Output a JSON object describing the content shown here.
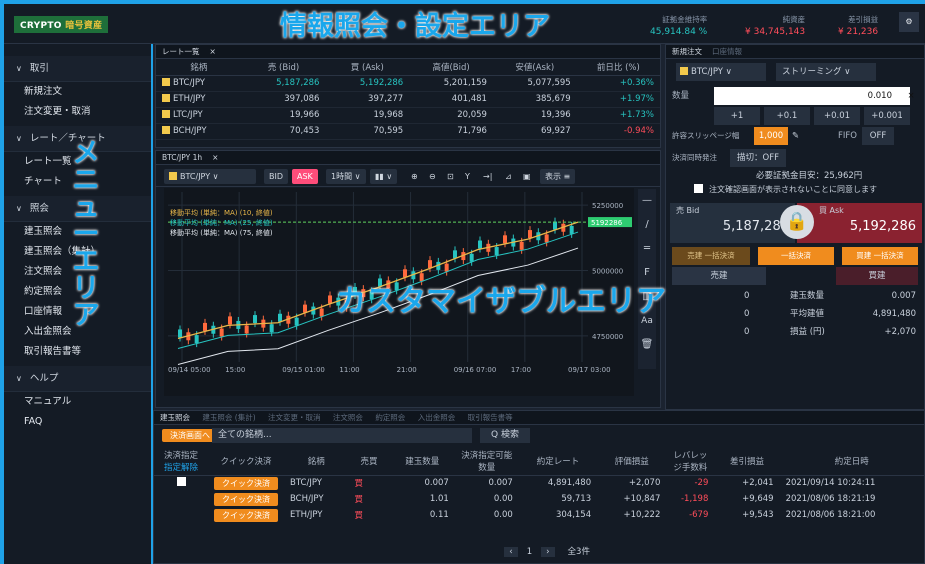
{
  "header": {
    "logo_a": "CRYPTO ",
    "logo_b": "暗号資産",
    "stats": [
      {
        "label": "証拠金維持率",
        "value": "45,914.84 %"
      },
      {
        "label": "純資産",
        "value": "¥ 34,745,143"
      },
      {
        "label": "差引損益",
        "value": "¥ 21,236"
      }
    ],
    "icon": "gear-icon"
  },
  "sidebar": {
    "sections": [
      {
        "label": "取引",
        "items": [
          "新規注文",
          "注文変更・取消"
        ]
      },
      {
        "label": "レート／チャート",
        "items": [
          "レート一覧",
          "チャート"
        ]
      },
      {
        "label": "照会",
        "items": [
          "建玉照会",
          "建玉照会（集計）",
          "注文照会",
          "約定照会",
          "口座情報",
          "入出金照会",
          "取引報告書等"
        ]
      },
      {
        "label": "ヘルプ",
        "items": [
          "マニュアル",
          "FAQ"
        ]
      }
    ]
  },
  "rates": {
    "tab": "レート一覧",
    "headers": [
      "銘柄",
      "売 (Bid)",
      "買 (Ask)",
      "高値(Bid)",
      "安値(Ask)",
      "前日比 (%)"
    ],
    "rows": [
      [
        "BTC/JPY",
        "5,187,286",
        "5,192,286",
        "5,201,159",
        "5,077,595",
        "+0.36%"
      ],
      [
        "ETH/JPY",
        "397,086",
        "397,277",
        "401,481",
        "385,679",
        "+1.97%"
      ],
      [
        "LTC/JPY",
        "19,966",
        "19,968",
        "20,059",
        "19,396",
        "+1.73%"
      ],
      [
        "BCH/JPY",
        "70,453",
        "70,595",
        "71,796",
        "69,927",
        "-0.94%"
      ]
    ]
  },
  "chart_panel": {
    "tab": "BTC/JPY 1h",
    "symbol": "BTC/JPY",
    "bid": "BID",
    "ask": "ASK",
    "interval": "1時間",
    "display": "表示",
    "legend": [
      "移動平均 (単純：MA) (10, 終値)",
      "移動平均 (単純：MA) (25, 終値)",
      "移動平均 (単純：MA) (75, 終値)"
    ],
    "price_tag": "5192286"
  },
  "chart_data": {
    "type": "line",
    "title": "",
    "x": [
      "09/14 05:00",
      "15:00",
      "09/15 01:00",
      "11:00",
      "21:00",
      "09/16 07:00",
      "17:00",
      "09/17 03:00"
    ],
    "y_ticks": [
      "5250000",
      "5000000",
      "4750000"
    ],
    "ylim": [
      4650000,
      5300000
    ],
    "series": [
      {
        "values": [
          4740000,
          4790000,
          4800000,
          4870000,
          4935000,
          5005000,
          5080000,
          5120000,
          5185000
        ]
      }
    ],
    "grid": true
  },
  "order": {
    "tab": "新規注文",
    "tab2": "口座情報",
    "symbol": "BTC/JPY",
    "mode": "ストリーミング",
    "qty_label": "数量",
    "qty": "0.010",
    "steps": [
      "+1",
      "+0.1",
      "+0.01",
      "+0.001"
    ],
    "slip_label": "許容スリッページ幅",
    "slip": "1,000",
    "fifo_label": "FIFO",
    "fifo": "OFF",
    "settle_label": "決済同時発注",
    "settle": "描切：OFF",
    "margin_label": "必要証拠金目安：",
    "margin": "25,962円",
    "confirm": "注文確認画面が表示されないことに同意します",
    "bid_label": "売 Bid",
    "bid": "5,187,286",
    "ask_label": "買 Ask",
    "ask": "5,192,286",
    "btn_sell": "売建 一括決済",
    "btn_all": "一括決済",
    "btn_buy": "買建 一括決済",
    "sum_sell": "売建",
    "sum_buy": "買建",
    "summary": [
      [
        "0",
        "建玉数量",
        "0.007"
      ],
      [
        "0",
        "平均建値",
        "4,891,480"
      ],
      [
        "0",
        "損益 (円)",
        "+2,070"
      ]
    ]
  },
  "bottom": {
    "tabs": [
      "建玉照会",
      "建玉照会 (集計)",
      "注文変更・取消",
      "注文照会",
      "約定照会",
      "入出金照会",
      "取引報告書等"
    ],
    "settle_btn": "決済画面へ",
    "filter": "全ての銘柄...",
    "search": "Q 検索",
    "headers": [
      "決済指定",
      "クイック決済",
      "銘柄",
      "売買",
      "建玉数量",
      "決済指定可能数量",
      "約定レート",
      "評価損益",
      "レバレッジ手数料",
      "差引損益",
      "約定日時"
    ],
    "sub": "指定解除",
    "quick": "クイック決済",
    "rows": [
      [
        "BTC/JPY",
        "買",
        "0.007",
        "0.007",
        "4,891,480",
        "+2,070",
        "-29",
        "+2,041",
        "2021/09/14 10:24:11"
      ],
      [
        "BCH/JPY",
        "買",
        "1.01",
        "0.00",
        "59,713",
        "+10,847",
        "-1,198",
        "+9,649",
        "2021/08/06 18:21:19"
      ],
      [
        "ETH/JPY",
        "買",
        "0.11",
        "0.00",
        "304,154",
        "+10,222",
        "-679",
        "+9,543",
        "2021/08/06 18:21:00"
      ]
    ],
    "page": "1",
    "total": "全3件"
  },
  "overlays": {
    "top": "情報照会・設定エリア",
    "menu": "メニューエリア",
    "custom": "カスタマイザブルエリア"
  },
  "colors": {
    "accent": "#1fa2e8",
    "up": "#27c4c1",
    "down": "#ff4d5a",
    "orange": "#f08c1e"
  }
}
